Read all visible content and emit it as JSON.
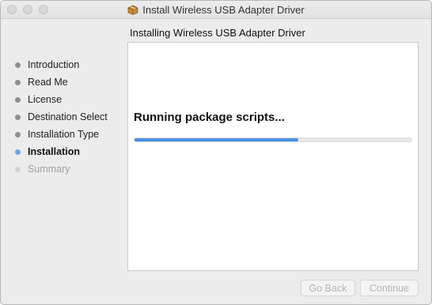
{
  "window": {
    "title": "Install Wireless USB Adapter Driver",
    "title_icon": "package-icon"
  },
  "header": {
    "subtitle": "Installing Wireless USB Adapter Driver"
  },
  "sidebar": {
    "steps": [
      {
        "label": "Introduction",
        "state": "done"
      },
      {
        "label": "Read Me",
        "state": "done"
      },
      {
        "label": "License",
        "state": "done"
      },
      {
        "label": "Destination Select",
        "state": "done"
      },
      {
        "label": "Installation Type",
        "state": "done"
      },
      {
        "label": "Installation",
        "state": "current"
      },
      {
        "label": "Summary",
        "state": "future"
      }
    ]
  },
  "main": {
    "status": "Running package scripts...",
    "progress_fraction": 0.59
  },
  "buttons": {
    "back_label": "Go Back",
    "continue_label": "Continue"
  },
  "colors": {
    "accent": "#4a90e2",
    "current_step_dot": "#6ea3e8"
  }
}
